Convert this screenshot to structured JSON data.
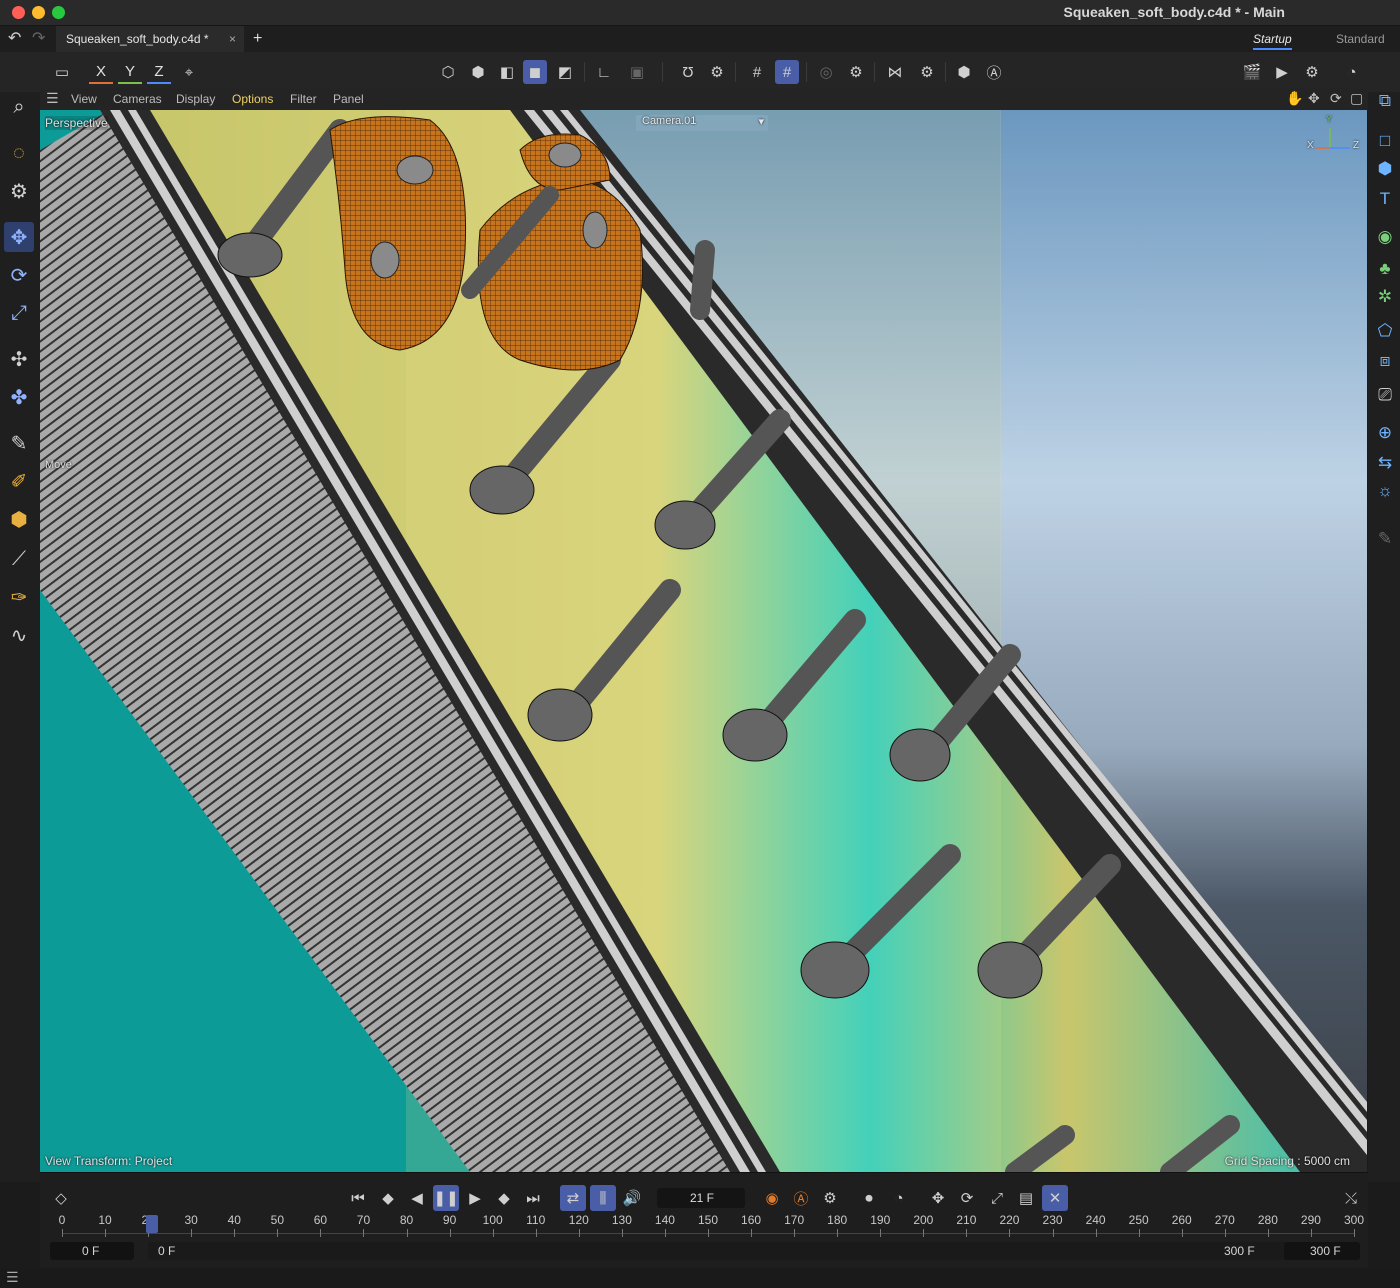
{
  "window": {
    "title": "Squeaken_soft_body.c4d * - Main"
  },
  "tabs": {
    "file_tab": "Squeaken_soft_body.c4d *",
    "close": "×",
    "add": "+",
    "layout_active": "Startup",
    "layout_other": "Standard"
  },
  "axis_buttons": {
    "x": "X",
    "y": "Y",
    "z": "Z"
  },
  "viewport_menu": {
    "items": [
      "View",
      "Cameras",
      "Display",
      "Options",
      "Filter",
      "Panel"
    ],
    "active": "Options"
  },
  "viewport": {
    "camera_label": "Perspective",
    "camera_dropdown": "Camera.01",
    "tool_label": "Move",
    "view_transform": "View Transform: Project",
    "grid_spacing": "Grid Spacing : 5000 cm",
    "axis_y": "Y",
    "axis_x": "X",
    "axis_z": "Z"
  },
  "timeline": {
    "current_frame": "21 F",
    "current_frame_value": 21,
    "ticks": [
      "0",
      "10",
      "20",
      "30",
      "40",
      "50",
      "60",
      "70",
      "80",
      "90",
      "100",
      "110",
      "120",
      "130",
      "140",
      "150",
      "160",
      "170",
      "180",
      "190",
      "200",
      "210",
      "220",
      "230",
      "240",
      "250",
      "260",
      "270",
      "280",
      "290",
      "300"
    ],
    "range_start": "0 F",
    "preview_start": "0 F",
    "preview_end": "300 F",
    "range_end": "300 F"
  },
  "colors": {
    "accent": "#4a5ea8",
    "viewport_teal": "#0d9b98",
    "layout_active": "#4a8cff"
  }
}
